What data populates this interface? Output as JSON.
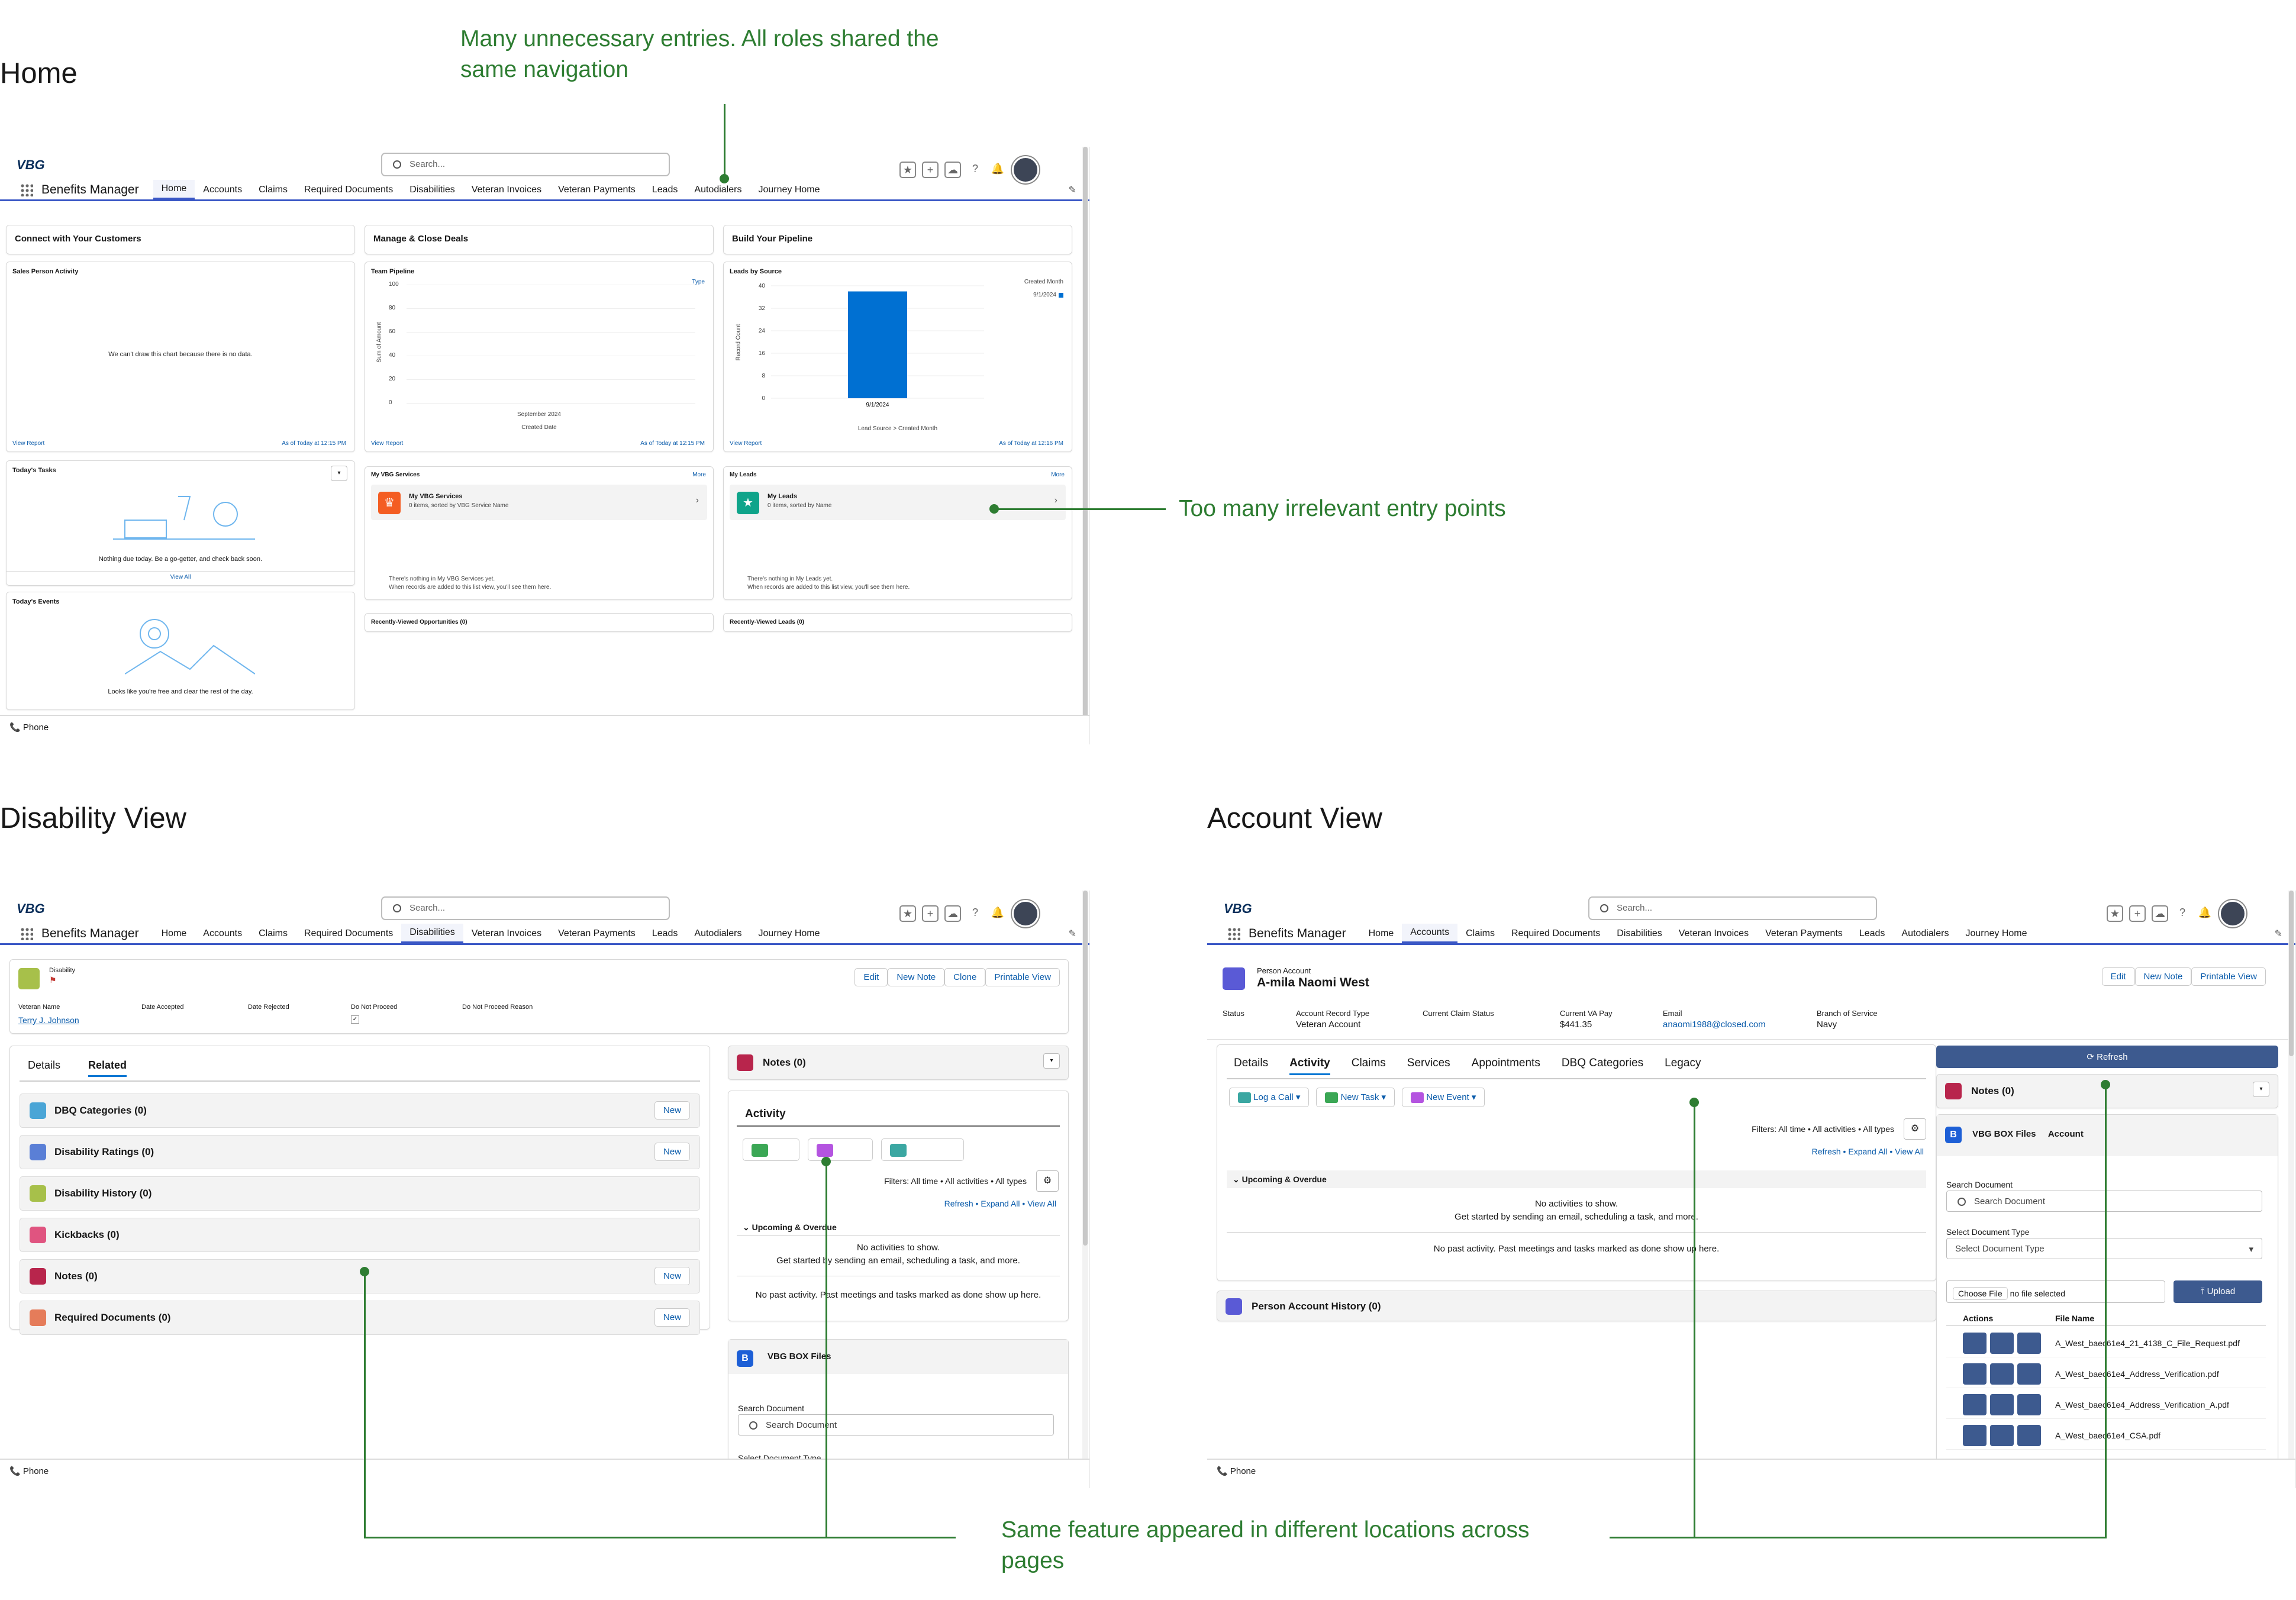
{
  "titles": {
    "home": "Home",
    "disability": "Disability View",
    "account": "Account View"
  },
  "annotations": {
    "nav": "Many unnecessary entries. All roles shared the same navigation",
    "entry": "Too many irrelevant entry points",
    "same": "Same feature appeared in different locations across pages"
  },
  "header": {
    "logo": "VBG",
    "search_placeholder": "Search...",
    "app_name": "Benefits Manager"
  },
  "nav": [
    "Home",
    "Accounts",
    "Claims",
    "Required Documents",
    "Disabilities",
    "Veteran Invoices",
    "Veteran Payments",
    "Leads",
    "Autodialers",
    "Journey Home"
  ],
  "footer": {
    "phone": "Phone"
  },
  "home": {
    "c1": "Connect with Your Customers",
    "c2": "Manage & Close Deals",
    "c3": "Build Your Pipeline",
    "spa": "Sales Person Activity",
    "spa_empty": "We can't draw this chart because there is no data.",
    "view_report": "View Report",
    "asof1": "As of Today at 12:15 PM",
    "asof2": "As of Today at 12:15 PM",
    "asof3": "As of Today at 12:16 PM",
    "team": "Team Pipeline",
    "team_legend": "Type",
    "team_y": "Sum of Amount",
    "team_x": "September 2024",
    "team_xl": "Created Date",
    "team_ticks": [
      "100",
      "80",
      "60",
      "40",
      "20",
      "0"
    ],
    "leads": "Leads by Source",
    "leads_legend": "Created Month",
    "leads_legend_item": "9/1/2024",
    "leads_y": "Record Count",
    "leads_ticks": [
      "40",
      "32",
      "24",
      "16",
      "8",
      "0"
    ],
    "leads_bar_label": "9/1/2024",
    "leads_xl": "Lead Source > Created Month",
    "tasks": "Today's Tasks",
    "tasks_empty": "Nothing due today. Be a go-getter, and check back soon.",
    "view_all": "View All",
    "events": "Today's Events",
    "events_empty": "Looks like you're free and clear the rest of the day.",
    "vbg_services": "My VBG Services",
    "more": "More",
    "vbg_services_item": "My VBG Services",
    "vbg_services_sub": "0 items, sorted by VBG Service Name",
    "vbg_empty1": "There's nothing in My VBG Services yet.",
    "vbg_empty2": "When records are added to this list view, you'll see them here.",
    "my_leads": "My Leads",
    "my_leads_item": "My Leads",
    "my_leads_sub": "0 items, sorted by Name",
    "leads_empty1": "There's nothing in My Leads yet.",
    "leads_empty2": "When records are added to this list view, you'll see them here.",
    "rv_opp": "Recently-Viewed Opportunities (0)",
    "rv_leads": "Recently-Viewed Leads (0)"
  },
  "chart_data": {
    "type": "bar",
    "title": "Leads by Source",
    "xlabel": "Lead Source > Created Month",
    "ylabel": "Record Count",
    "categories": [
      "9/1/2024"
    ],
    "values": [
      38
    ],
    "ylim": [
      0,
      40
    ]
  },
  "disability": {
    "object": "Disability",
    "edit": "Edit",
    "new_note": "New Note",
    "clone": "Clone",
    "printable": "Printable View",
    "f_labels": [
      "Veteran Name",
      "Date Accepted",
      "Date Rejected",
      "Do Not Proceed",
      "Do Not Proceed Reason"
    ],
    "veteran": "Terry J. Johnson",
    "tabs": [
      "Details",
      "Related"
    ],
    "related": [
      {
        "label": "DBQ Categories (0)",
        "color": "#4aa5d6",
        "new": true
      },
      {
        "label": "Disability Ratings (0)",
        "color": "#5a7fd6",
        "new": true
      },
      {
        "label": "Disability History (0)",
        "color": "#a7c04a",
        "new": false
      },
      {
        "label": "Kickbacks (0)",
        "color": "#e05480",
        "new": false
      },
      {
        "label": "Notes (0)",
        "color": "#b8254c",
        "new": true
      },
      {
        "label": "Required Documents (0)",
        "color": "#e57c5a",
        "new": true
      }
    ],
    "new": "New",
    "notes": "Notes (0)",
    "activity": "Activity",
    "filters": "Filters: All time • All activities • All types",
    "refresh": "Refresh",
    "expand_all": "Expand All",
    "view_all": "View All",
    "upcoming": "Upcoming & Overdue",
    "no_act": "No activities to show.",
    "get_started": "Get started by sending an email, scheduling a task, and more.",
    "no_past": "No past activity. Past meetings and tasks marked as done show up here.",
    "box": "VBG BOX Files",
    "search_doc": "Search Document",
    "search_doc_ph": "Search Document",
    "select_type": "Select Document Type"
  },
  "account": {
    "object": "Person Account",
    "name": "A-mila Naomi West",
    "edit": "Edit",
    "new_note": "New Note",
    "printable": "Printable View",
    "f_labels": [
      "Status",
      "Account Record Type",
      "Current Claim Status",
      "Current VA Pay",
      "Email",
      "Branch of Service"
    ],
    "f_values": [
      "",
      "Veteran Account",
      "",
      "$441.35",
      "anaomi1988@closed.com",
      "Navy"
    ],
    "tabs": [
      "Details",
      "Activity",
      "Claims",
      "Services",
      "Appointments",
      "DBQ Categories",
      "Legacy"
    ],
    "log_call": "Log a Call",
    "new_task": "New Task",
    "new_event": "New Event",
    "filters": "Filters: All time • All activities • All types",
    "refresh": "Refresh",
    "expand_all": "Expand All",
    "view_all": "View All",
    "upcoming": "Upcoming & Overdue",
    "no_act": "No activities to show.",
    "get_started": "Get started by sending an email, scheduling a task, and more.",
    "no_past": "No past activity. Past meetings and tasks marked as done show up here.",
    "history": "Person Account History (0)",
    "refresh_btn": "Refresh",
    "notes": "Notes (0)",
    "box": "VBG BOX Files",
    "box_account": "Account",
    "search_doc": "Search Document",
    "search_doc_ph": "Search Document",
    "select_type": "Select Document Type",
    "select_type_ph": "Select Document Type",
    "choose_file": "Choose File",
    "no_file": "no file selected",
    "upload": "Upload",
    "col_actions": "Actions",
    "col_file": "File Name",
    "files": [
      "A_West_baec61e4_21_4138_C_File_Request.pdf",
      "A_West_baec61e4_Address_Verification.pdf",
      "A_West_baec61e4_Address_Verification_A.pdf",
      "A_West_baec61e4_CSA.pdf"
    ]
  }
}
